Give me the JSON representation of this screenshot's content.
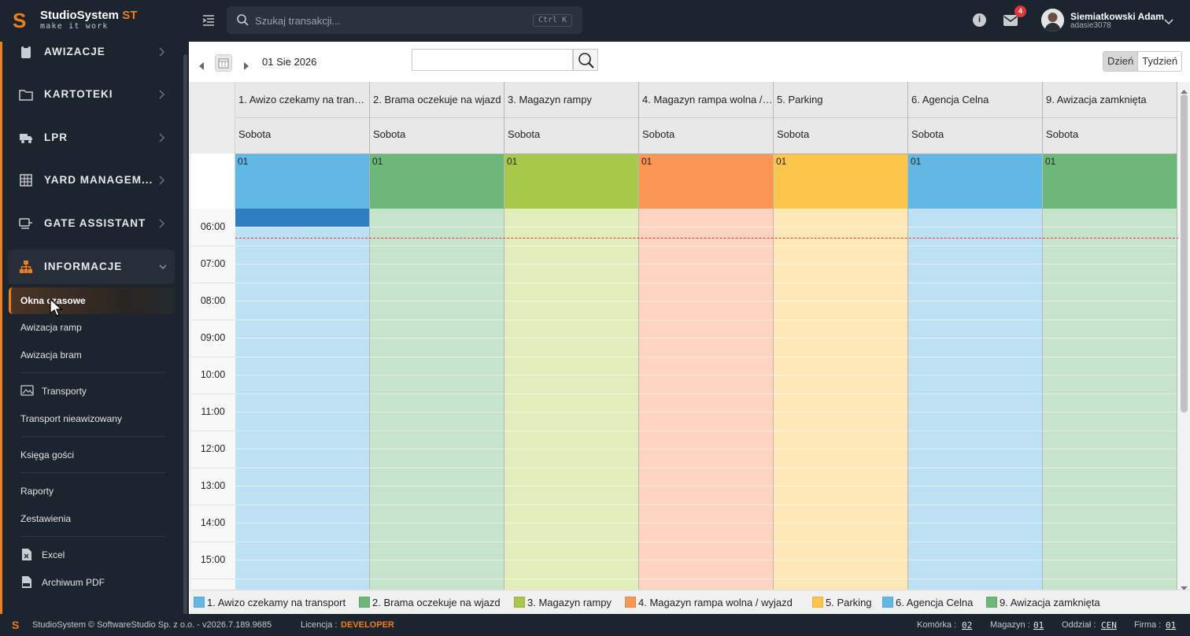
{
  "app": {
    "brand": "StudioSystem",
    "brand_suffix": "ST",
    "tagline": "make it work"
  },
  "search": {
    "placeholder": "Szukaj transakcji...",
    "shortcut": "Ctrl K"
  },
  "notifications": {
    "count": "4"
  },
  "user": {
    "name": "Siemiatkowski Adam",
    "login": "adasie3078"
  },
  "sidebar": {
    "items": [
      {
        "label": "AWIZACJE",
        "icon": "clipboard-icon"
      },
      {
        "label": "KARTOTEKI",
        "icon": "folder-icon"
      },
      {
        "label": "LPR",
        "icon": "truck-icon"
      },
      {
        "label": "YARD MANAGEM...",
        "icon": "grid-icon"
      },
      {
        "label": "GATE ASSISTANT",
        "icon": "gate-icon"
      },
      {
        "label": "INFORMACJE",
        "icon": "sitemap-icon"
      }
    ],
    "subitems": {
      "okna": "Okna czasowe",
      "ramp": "Awizacja ramp",
      "bram": "Awizacja bram",
      "transporty": "Transporty",
      "nieawizowany": "Transport nieawizowany",
      "goscie": "Księga gości",
      "raporty": "Raporty",
      "zestawienia": "Zestawienia",
      "excel": "Excel",
      "pdf": "Archiwum PDF"
    }
  },
  "toolbar": {
    "date": "01 Sie 2026",
    "view_day": "Dzień",
    "view_week": "Tydzień"
  },
  "calendar": {
    "columns": [
      {
        "title": "1. Awizo czekamy na transport",
        "day": "Sobota",
        "allday": "01",
        "color": "#62b8e4",
        "body": "#bde0f2"
      },
      {
        "title": "2. Brama oczekuje na wjazd",
        "day": "Sobota",
        "allday": "01",
        "color": "#6cb87a",
        "body": "#c6e3cb"
      },
      {
        "title": "3. Magazyn rampy",
        "day": "Sobota",
        "allday": "01",
        "color": "#a8c84a",
        "body": "#e3edbc"
      },
      {
        "title": "4. Magazyn rampa wolna / wyjazd",
        "day": "Sobota",
        "allday": "01",
        "color": "#fb9653",
        "body": "#fed3bf"
      },
      {
        "title": "5. Parking",
        "day": "Sobota",
        "allday": "01",
        "color": "#fec54b",
        "body": "#ffe8b8"
      },
      {
        "title": "6. Agencja Celna",
        "day": "Sobota",
        "allday": "01",
        "color": "#62b8e4",
        "body": "#bde0f2"
      },
      {
        "title": "9. Awizacja zamknięta",
        "day": "Sobota",
        "allday": "01",
        "color": "#6cb87a",
        "body": "#c6e3cb"
      }
    ],
    "times": [
      "06:00",
      "07:00",
      "08:00",
      "09:00",
      "10:00",
      "11:00",
      "12:00",
      "13:00",
      "14:00",
      "15:00"
    ]
  },
  "legend": [
    {
      "label": "1. Awizo czekamy na transport",
      "color": "#62b8e4"
    },
    {
      "label": "2. Brama oczekuje na wjazd",
      "color": "#6cb87a"
    },
    {
      "label": "3. Magazyn rampy",
      "color": "#a8c84a"
    },
    {
      "label": "4. Magazyn rampa wolna / wyjazd",
      "color": "#fb9653"
    },
    {
      "label": "5. Parking",
      "color": "#fec54b"
    },
    {
      "label": "6. Agencja Celna",
      "color": "#62b8e4"
    },
    {
      "label": "9. Awizacja zamknięta",
      "color": "#6cb87a"
    }
  ],
  "footer": {
    "copyright": "StudioSystem © SoftwareStudio Sp. z o.o. - v2026.7.189.9685",
    "license_label": "Licencja :",
    "license_value": "DEVELOPER",
    "komorka_label": "Komórka :",
    "komorka_value": "02",
    "magazyn_label": "Magazyn :",
    "magazyn_value": "01",
    "oddzial_label": "Oddział :",
    "oddzial_value": "CEN",
    "firma_label": "Firma :",
    "firma_value": "01"
  }
}
